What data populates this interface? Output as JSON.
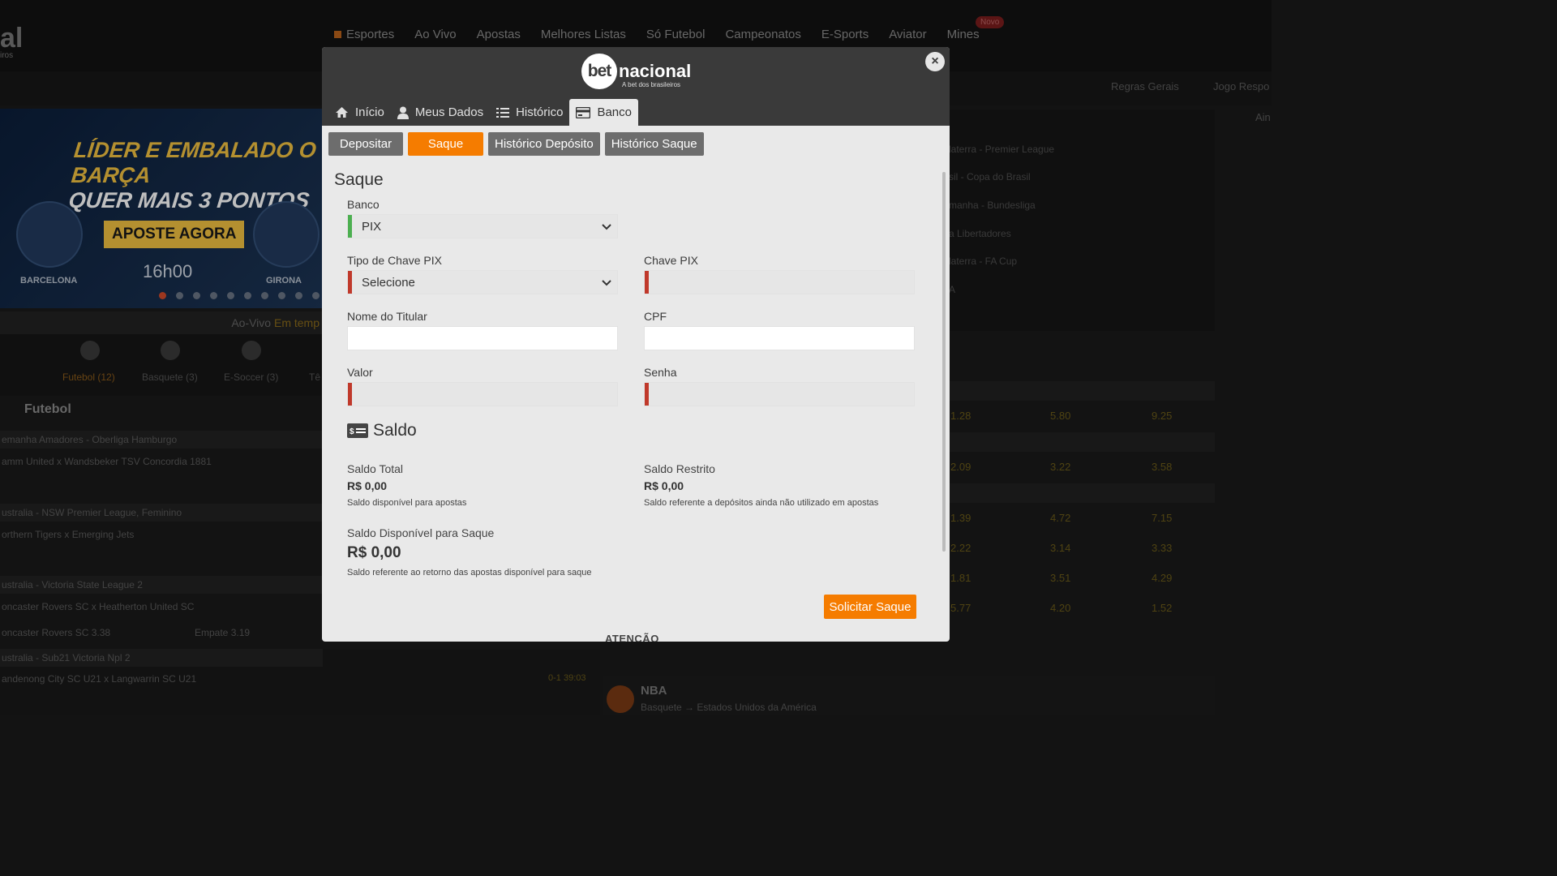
{
  "background": {
    "logo_fragment": "al",
    "logo_sub": "iros",
    "nav": [
      "Esportes",
      "Ao Vivo",
      "Apostas",
      "Melhores Listas",
      "Só Futebol",
      "Campeonatos",
      "E-Sports",
      "Aviator",
      "Mines"
    ],
    "nav_badge": "Novo",
    "subbar_links": [
      "Regras Gerais",
      "Jogo Respo"
    ],
    "right_edge_text": "Ain",
    "banner": {
      "title_line1": "LÍDER E EMBALADO O BARÇA",
      "title_line2": "QUER MAIS 3 PONTOS",
      "cta": "APOSTE AGORA",
      "time": "16h00",
      "team1": "BARCELONA",
      "team2": "GIRONA"
    },
    "live_label": "Ao-Vivo",
    "live_label_accent": "Em temp",
    "sports": [
      "Futebol (12)",
      "Basquete (3)",
      "E-Soccer (3)",
      "Tê"
    ],
    "futebol_title": "Futebol",
    "left_rows": [
      {
        "text": "emanha Amadores - Oberliga Hamburgo",
        "header": true
      },
      {
        "text": "amm United x Wandsbeker TSV Concordia 1881",
        "header": false
      },
      {
        "text": "ustralia - NSW Premier League, Feminino",
        "header": true
      },
      {
        "text": "orthern Tigers x Emerging Jets",
        "header": false
      },
      {
        "text": "ustralia - Victoria State League 2",
        "header": true
      },
      {
        "text": "oncaster Rovers SC x Heatherton United SC",
        "header": false
      },
      {
        "text": "oncaster Rovers SC 3.38",
        "header": false
      },
      {
        "text": "ustralia - Sub21 Victoria Npl 2",
        "header": true
      },
      {
        "text": "andenong City SC U21 x Langwarrin SC U21",
        "header": false
      }
    ],
    "empate": "Empate 3.19",
    "live_score": "0-1   39:03",
    "right_leagues": [
      "laterra - Premier League",
      "sil - Copa do Brasil",
      "manha - Bundesliga",
      "a Libertadores",
      "laterra - FA Cup",
      "A"
    ],
    "odds_rows": [
      [
        "1.28",
        "5.80",
        "9.25"
      ],
      [
        "2.09",
        "3.22",
        "3.58"
      ],
      [
        "1.39",
        "4.72",
        "7.15"
      ],
      [
        "2.22",
        "3.14",
        "3.33"
      ],
      [
        "1.81",
        "3.51",
        "4.29"
      ],
      [
        "5.77",
        "4.20",
        "1.52"
      ]
    ],
    "nba_title": "NBA",
    "nba_sub": "Basquete → Estados Unidos da América"
  },
  "modal": {
    "brand_bet": "bet",
    "brand_name": "nacional",
    "brand_tagline": "A bet dos brasileiros",
    "close_label": "×",
    "tabs": [
      {
        "label": "Início",
        "icon": "home-icon"
      },
      {
        "label": "Meus Dados",
        "icon": "user-icon"
      },
      {
        "label": "Histórico",
        "icon": "list-icon"
      },
      {
        "label": "Banco",
        "icon": "card-icon"
      }
    ],
    "subtabs": [
      "Depositar",
      "Saque",
      "Histórico Depósito",
      "Histórico Saque"
    ],
    "section_title": "Saque",
    "form": {
      "banco_label": "Banco",
      "banco_value": "PIX",
      "tipo_label": "Tipo de Chave PIX",
      "tipo_value": "Selecione",
      "chave_label": "Chave PIX",
      "chave_value": "",
      "nome_label": "Nome do Titular",
      "nome_value": "",
      "cpf_label": "CPF",
      "cpf_value": "",
      "valor_label": "Valor",
      "valor_value": "",
      "senha_label": "Senha",
      "senha_value": ""
    },
    "colors": {
      "accent": "#f57c00",
      "valid": "#4caf50",
      "invalid": "#c0392b"
    },
    "saldo": {
      "title": "Saldo",
      "total_label": "Saldo Total",
      "total_value": "R$ 0,00",
      "total_desc": "Saldo disponível para apostas",
      "restrito_label": "Saldo Restrito",
      "restrito_value": "R$ 0,00",
      "restrito_desc": "Saldo referente a depósitos ainda não utilizado em apostas",
      "disponivel_label": "Saldo Disponível para Saque",
      "disponivel_value": "R$ 0,00",
      "disponivel_desc": "Saldo referente ao retorno das apostas disponível para saque"
    },
    "submit_label": "Solicitar Saque",
    "atencao": "ATENÇÃO"
  }
}
